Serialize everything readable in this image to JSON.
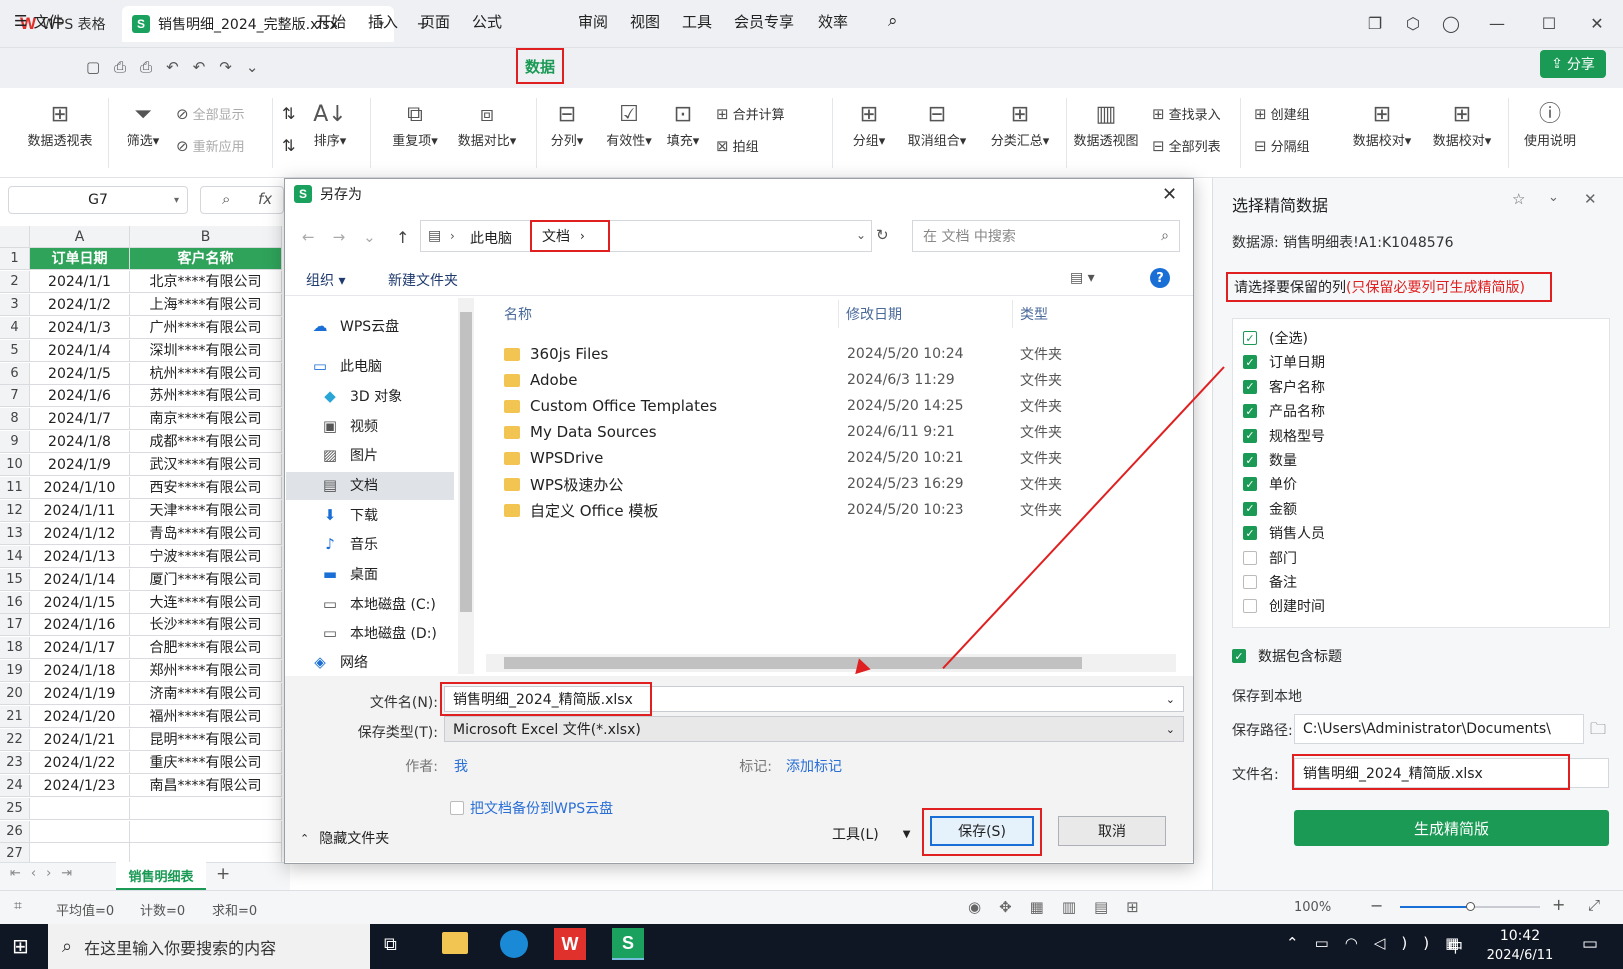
{
  "titlebar": {
    "app_tab": "WPS 表格",
    "file_tab": "销售明细_2024_完整版.xlsx"
  },
  "menubar": {
    "file": "文件",
    "items": [
      "开始",
      "插入",
      "页面",
      "公式",
      "数据",
      "审阅",
      "视图",
      "工具",
      "会员专享",
      "效率"
    ],
    "share": "分享"
  },
  "ribbon": {
    "pivot": "数据透视表",
    "filter": "筛选",
    "show_all": "全部显示",
    "reapply": "重新应用",
    "sort": "排序",
    "duplicates": "重复项",
    "compare": "数据对比",
    "split": "分列",
    "validity": "有效性",
    "fill": "填充",
    "merge_calc": "合并计算",
    "flash": "拍组",
    "group": "分组",
    "ungroup": "取消组合",
    "subtotal": "分类汇总",
    "pivot_chart": "数据透视图",
    "lookup_entry": "查找录入",
    "all_list": "全部列表",
    "create_group": "创建组",
    "split_group": "分隔组",
    "check1": "数据校对",
    "check2": "数据校对",
    "help": "使用说明"
  },
  "formula": {
    "cell_ref": "G7",
    "fx": "fx"
  },
  "sheet": {
    "columns": [
      "A",
      "B"
    ],
    "headers": [
      "订单日期",
      "客户名称"
    ],
    "rows": [
      [
        "2024/1/1",
        "北京****有限公司"
      ],
      [
        "2024/1/2",
        "上海****有限公司"
      ],
      [
        "2024/1/3",
        "广州****有限公司"
      ],
      [
        "2024/1/4",
        "深圳****有限公司"
      ],
      [
        "2024/1/5",
        "杭州****有限公司"
      ],
      [
        "2024/1/6",
        "苏州****有限公司"
      ],
      [
        "2024/1/7",
        "南京****有限公司"
      ],
      [
        "2024/1/8",
        "成都****有限公司"
      ],
      [
        "2024/1/9",
        "武汉****有限公司"
      ],
      [
        "2024/1/10",
        "西安****有限公司"
      ],
      [
        "2024/1/11",
        "天津****有限公司"
      ],
      [
        "2024/1/12",
        "青岛****有限公司"
      ],
      [
        "2024/1/13",
        "宁波****有限公司"
      ],
      [
        "2024/1/14",
        "厦门****有限公司"
      ],
      [
        "2024/1/15",
        "大连****有限公司"
      ],
      [
        "2024/1/16",
        "长沙****有限公司"
      ],
      [
        "2024/1/17",
        "合肥****有限公司"
      ],
      [
        "2024/1/18",
        "郑州****有限公司"
      ],
      [
        "2024/1/19",
        "济南****有限公司"
      ],
      [
        "2024/1/20",
        "福州****有限公司"
      ],
      [
        "2024/1/21",
        "昆明****有限公司"
      ],
      [
        "2024/1/22",
        "重庆****有限公司"
      ],
      [
        "2024/1/23",
        "南昌****有限公司"
      ]
    ],
    "tab": "销售明细表"
  },
  "status": {
    "avg": "平均值=0",
    "count": "计数=0",
    "sum": "求和=0",
    "zoom": "100%"
  },
  "taskbar": {
    "search": "在这里输入你要搜索的内容",
    "time": "10:42",
    "date": "2024/6/11",
    "ime": "中"
  },
  "dialog": {
    "title": "另存为",
    "path": [
      "此电脑",
      "文档"
    ],
    "search_placeholder": "在 文档 中搜索",
    "organize": "组织",
    "new_folder": "新建文件夹",
    "nav": [
      "WPS云盘",
      "此电脑",
      "3D 对象",
      "视频",
      "图片",
      "文档",
      "下载",
      "音乐",
      "桌面",
      "本地磁盘 (C:)",
      "本地磁盘 (D:)",
      "网络"
    ],
    "col_name": "名称",
    "col_date": "修改日期",
    "col_type": "类型",
    "files": [
      {
        "name": "360js Files",
        "date": "2024/5/20 10:24",
        "type": "文件夹"
      },
      {
        "name": "Adobe",
        "date": "2024/6/3 11:29",
        "type": "文件夹"
      },
      {
        "name": "Custom Office Templates",
        "date": "2024/5/20 14:25",
        "type": "文件夹"
      },
      {
        "name": "My Data Sources",
        "date": "2024/6/11 9:21",
        "type": "文件夹"
      },
      {
        "name": "WPSDrive",
        "date": "2024/5/20 10:21",
        "type": "文件夹"
      },
      {
        "name": "WPS极速办公",
        "date": "2024/5/23 16:29",
        "type": "文件夹"
      },
      {
        "name": "自定义 Office 模板",
        "date": "2024/5/20 10:23",
        "type": "文件夹"
      }
    ],
    "filename_label": "文件名(N):",
    "filename": "销售明细_2024_精简版.xlsx",
    "filetype_label": "保存类型(T):",
    "filetype": "Microsoft Excel 文件(*.xlsx)",
    "author_label": "作者:",
    "author": "我",
    "tag_label": "标记:",
    "tag": "添加标记",
    "backup": "把文档备份到WPS云盘",
    "hide_folders": "隐藏文件夹",
    "tools": "工具(L)",
    "save": "保存(S)",
    "cancel": "取消"
  },
  "panel": {
    "title": "选择精简数据",
    "source": "数据源:  销售明细表!A1:K1048576",
    "instruction_main": "请选择要保留的列",
    "instruction_note": "(只保留必要列可生成精简版)",
    "columns": [
      {
        "label": "(全选)",
        "state": "sel"
      },
      {
        "label": "订单日期",
        "state": "on"
      },
      {
        "label": "客户名称",
        "state": "on"
      },
      {
        "label": "产品名称",
        "state": "on"
      },
      {
        "label": "规格型号",
        "state": "on"
      },
      {
        "label": "数量",
        "state": "on"
      },
      {
        "label": "单价",
        "state": "on"
      },
      {
        "label": "金额",
        "state": "on"
      },
      {
        "label": "销售人员",
        "state": "on"
      },
      {
        "label": "部门",
        "state": "off"
      },
      {
        "label": "备注",
        "state": "off"
      },
      {
        "label": "创建时间",
        "state": "off"
      }
    ],
    "include_header": "数据包含标题",
    "save_local": "保存到本地",
    "path_label": "保存路径:",
    "path": "C:\\Users\\Administrator\\Documents\\",
    "name_label": "文件名:",
    "name": "销售明细_2024_精简版.xlsx",
    "generate": "生成精简版"
  }
}
